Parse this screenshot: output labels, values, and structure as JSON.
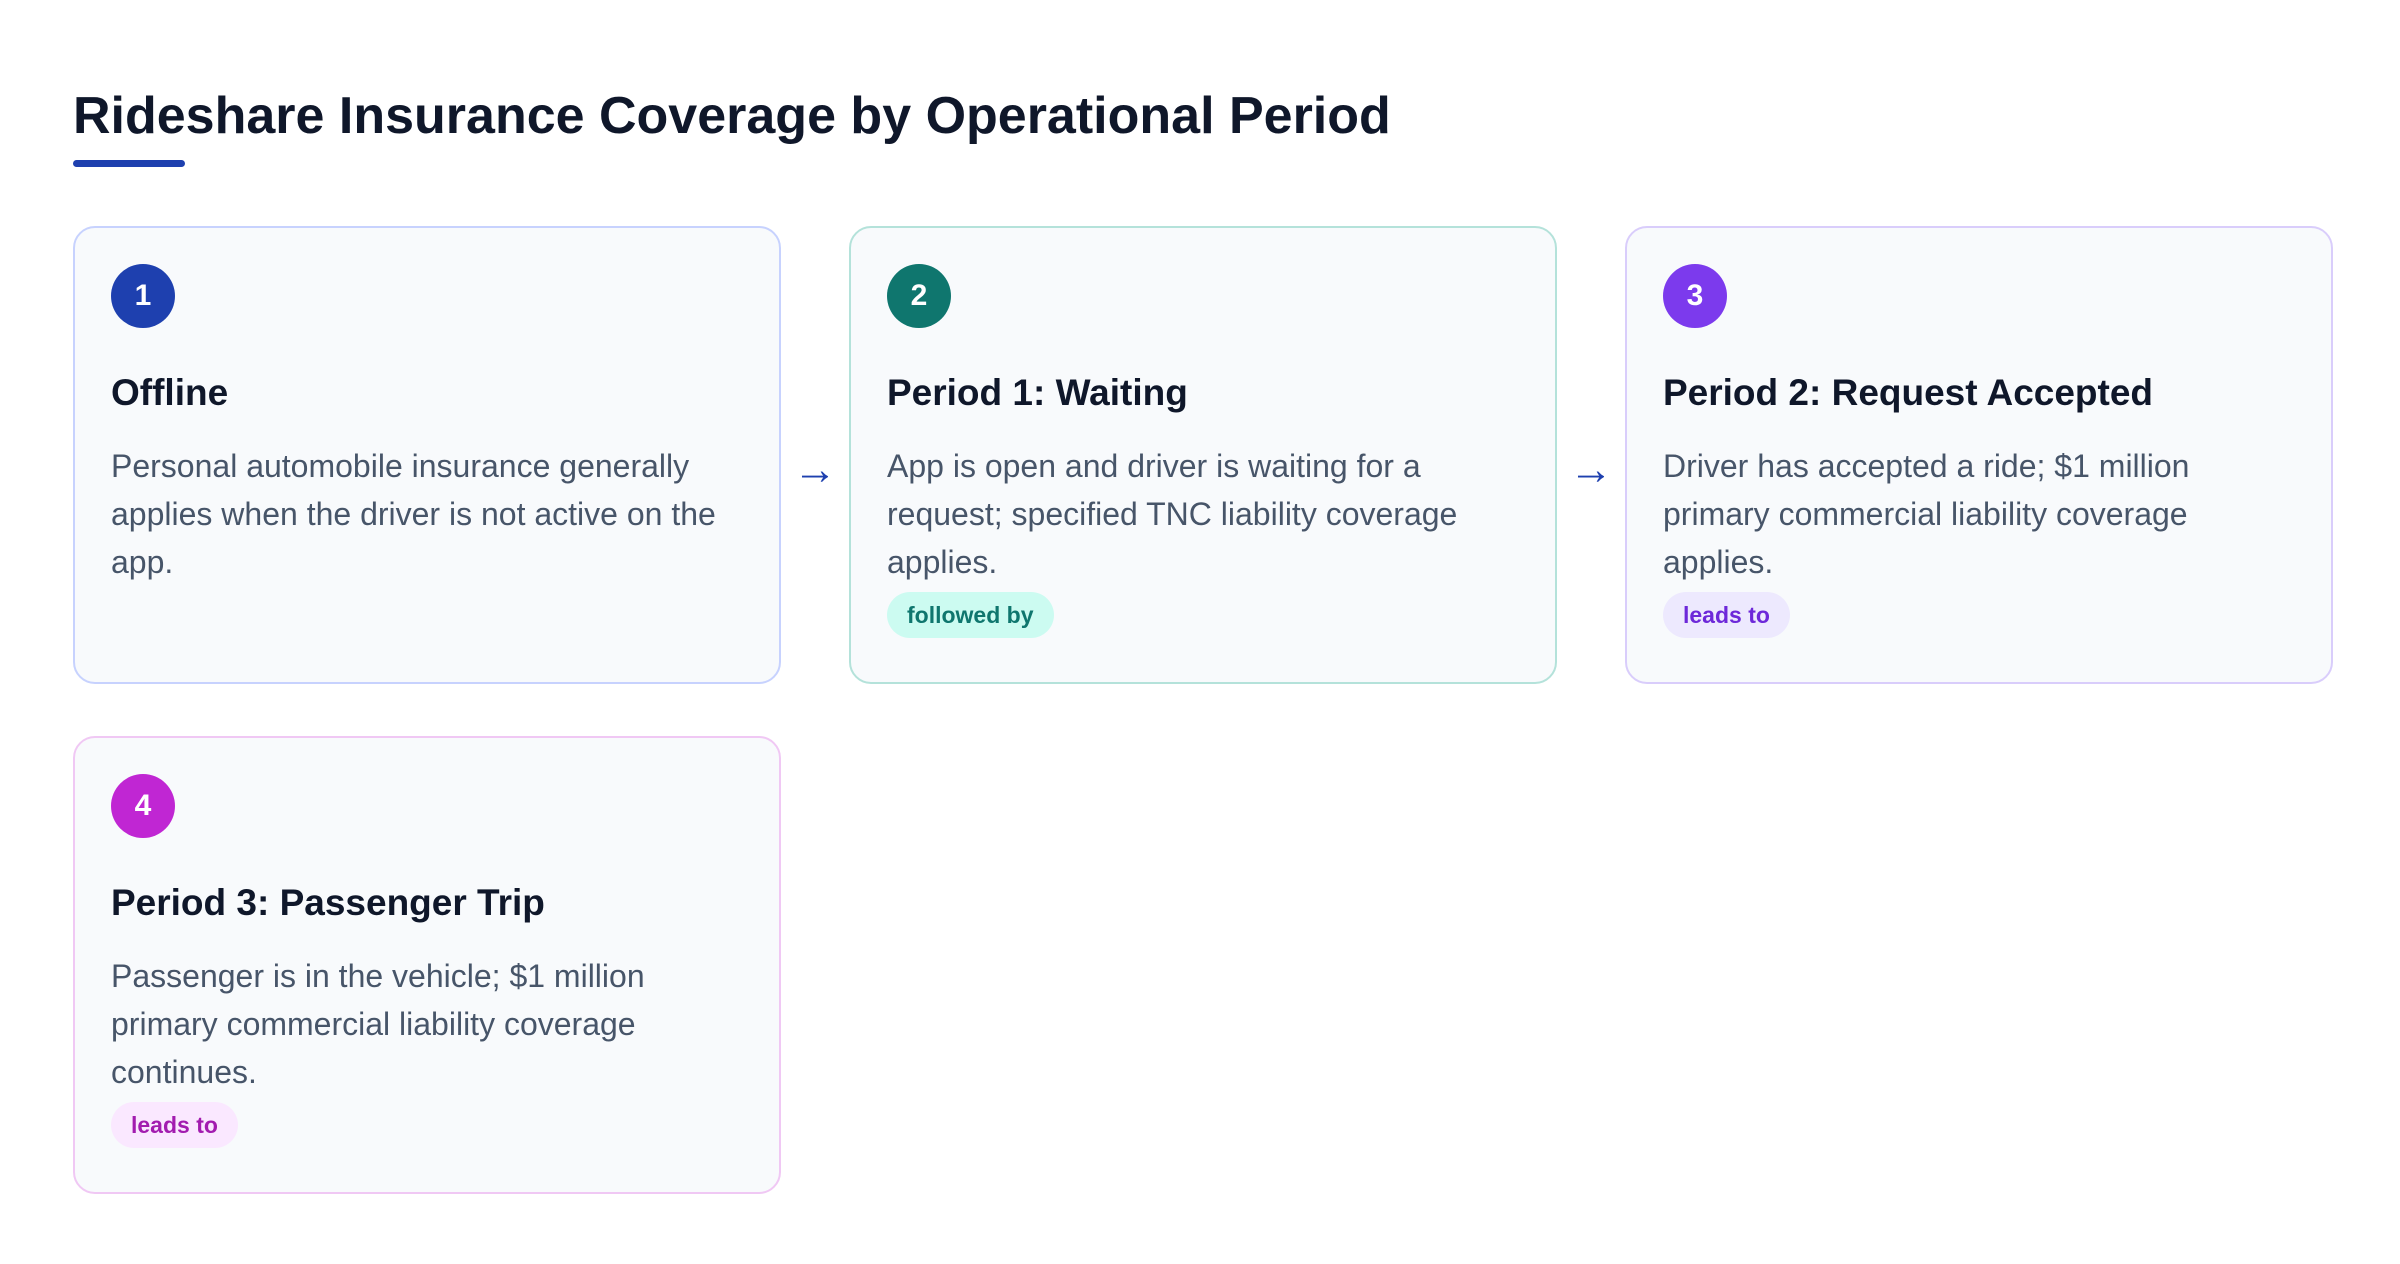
{
  "title": "Rideshare Insurance Coverage by Operational Period",
  "colors": {
    "accent": "#1e40af",
    "step1": "#1e40af",
    "step2": "#0f766e",
    "step3": "#7c3aed",
    "step4": "#c026d3"
  },
  "connector_icon": "right-arrow-icon",
  "connector_glyph": "→",
  "steps": [
    {
      "number": "1",
      "title": "Offline",
      "description": "Personal automobile insurance generally applies when the driver is not active on the app.",
      "badge": ""
    },
    {
      "number": "2",
      "title": "Period 1: Waiting",
      "description": "App is open and driver is waiting for a request; specified TNC liability coverage applies.",
      "badge": "followed by"
    },
    {
      "number": "3",
      "title": "Period 2: Request Accepted",
      "description": "Driver has accepted a ride; $1 million primary commercial liability coverage applies.",
      "badge": "leads to"
    },
    {
      "number": "4",
      "title": "Period 3: Passenger Trip",
      "description": "Passenger is in the vehicle; $1 million primary commercial liability coverage continues.",
      "badge": "leads to"
    }
  ]
}
